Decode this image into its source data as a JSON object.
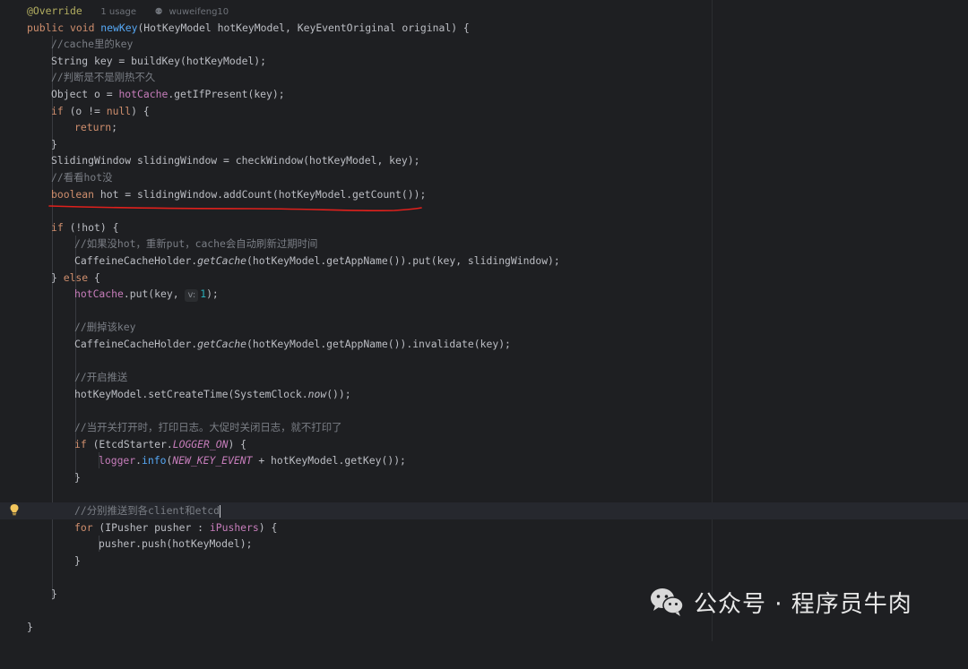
{
  "editor": {
    "usage_text": "1 usage",
    "author_text": "wuweifeng10",
    "inlay_hint": "v:",
    "lines": {
      "l01": "@Override",
      "l02a": "public void ",
      "l02b": "newKey",
      "l02c": "(HotKeyModel hotKeyModel, KeyEventOriginal original) {",
      "l03": "//cache里的key",
      "l04": "String key = buildKey(hotKeyModel);",
      "l05": "//判断是不是刚热不久",
      "l06a": "Object o = ",
      "l06b": "hotCache",
      "l06c": ".getIfPresent(key);",
      "l07a": "if",
      "l07b": " (o != ",
      "l07c": "null",
      "l07d": ") {",
      "l08a": "return",
      "l08b": ";",
      "l09": "}",
      "l10": "SlidingWindow slidingWindow = checkWindow(hotKeyModel, key);",
      "l11": "//看看hot没",
      "l12a": "boolean",
      "l12b": " hot = slidingWindow.addCount(hotKeyModel.getCount());",
      "l14a": "if",
      "l14b": " (!hot) {",
      "l15": "//如果没hot，重新put，cache会自动刷新过期时间",
      "l16a": "CaffeineCacheHolder.",
      "l16b": "getCache",
      "l16c": "(hotKeyModel.getAppName()).put(key, slidingWindow);",
      "l17a": "} ",
      "l17b": "else",
      "l17c": " {",
      "l18a": "hotCache",
      "l18b": ".put(key, ",
      "l18c": "1",
      "l18d": ");",
      "l20": "//删掉该key",
      "l21a": "CaffeineCacheHolder.",
      "l21b": "getCache",
      "l21c": "(hotKeyModel.getAppName()).invalidate(key);",
      "l23": "//开启推送",
      "l24a": "hotKeyModel.setCreateTime(SystemClock.",
      "l24b": "now",
      "l24c": "());",
      "l26": "//当开关打开时，打印日志。大促时关闭日志，就不打印了",
      "l27a": "if",
      "l27b": " (EtcdStarter.",
      "l27c": "LOGGER_ON",
      "l27d": ") {",
      "l28a": "logger",
      "l28b": ".",
      "l28c": "info",
      "l28d": "(",
      "l28e": "NEW_KEY_EVENT",
      "l28f": " + hotKeyModel.getKey());",
      "l29": "}",
      "l31": "//分别推送到各client和etcd",
      "l32a": "for",
      "l32b": " (IPusher pusher : ",
      "l32c": "iPushers",
      "l32d": ") {",
      "l33": "pusher.push(hotKeyModel);",
      "l34": "}",
      "l36": "}",
      "l38": "}"
    }
  },
  "watermark": {
    "text": "公众号 · 程序员牛肉",
    "icon": "wechat-icon"
  },
  "colors": {
    "background": "#1e1f22",
    "keyword": "#cf8e6d",
    "function": "#56a8f5",
    "field": "#c77dbb",
    "comment": "#7a7e85",
    "underline": "#e0201c"
  }
}
